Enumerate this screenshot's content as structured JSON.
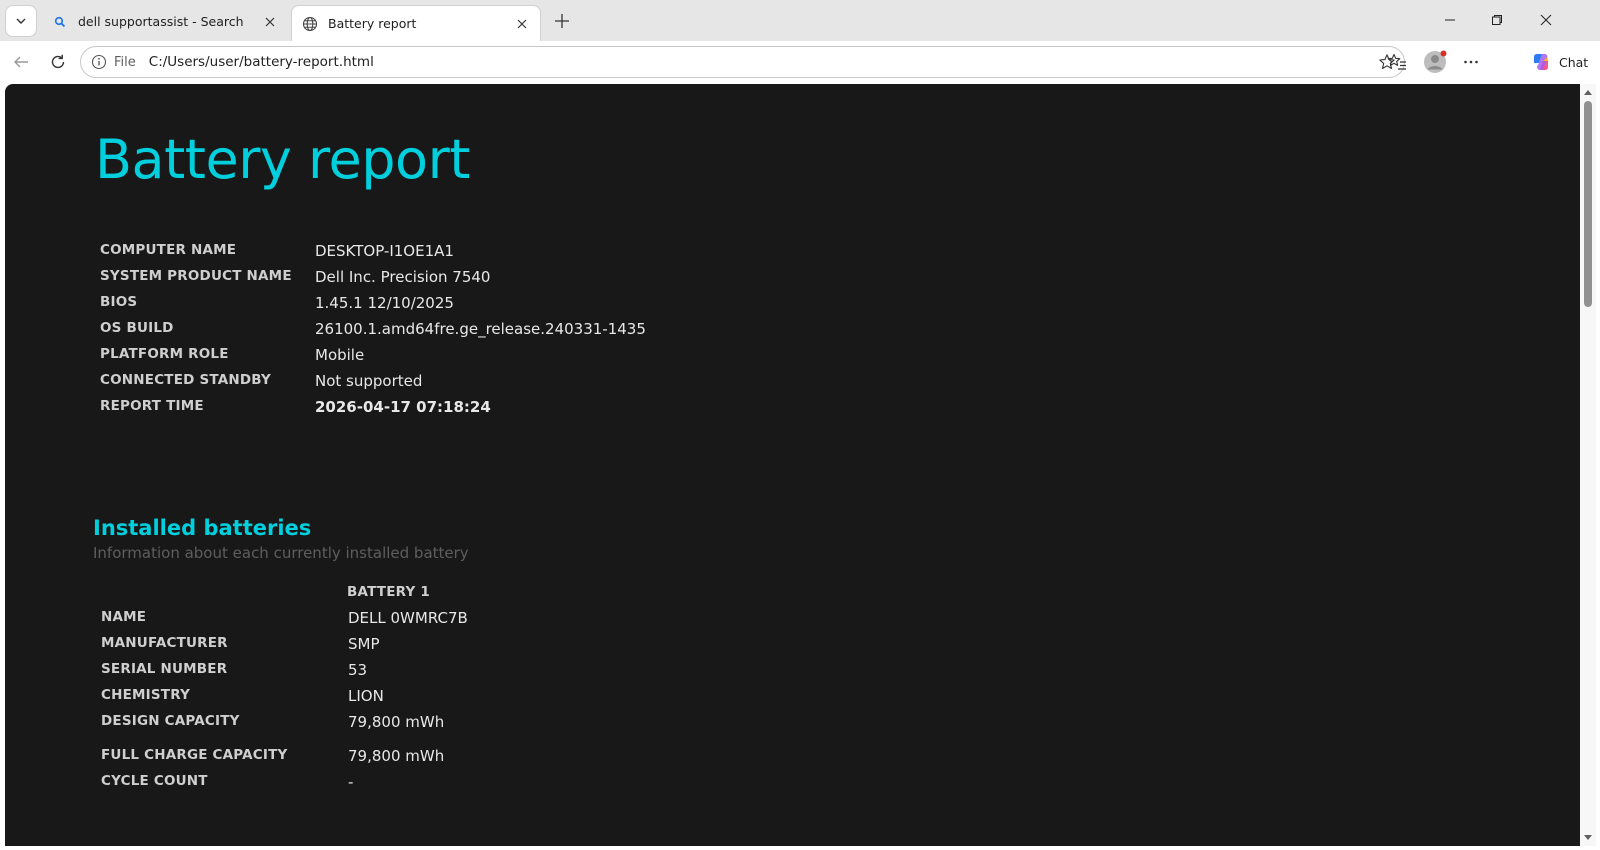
{
  "tabs": [
    {
      "title": "dell supportassist - Search",
      "icon": "search-icon"
    },
    {
      "title": "Battery report",
      "icon": "globe-icon"
    }
  ],
  "address": {
    "scheme_label": "File",
    "url": "C:/Users/user/battery-report.html"
  },
  "toolbar": {
    "chat_label": "Chat"
  },
  "report": {
    "title": "Battery report",
    "system": [
      {
        "label": "COMPUTER NAME",
        "value": "DESKTOP-I1OE1A1"
      },
      {
        "label": "SYSTEM PRODUCT NAME",
        "value": "Dell Inc. Precision 7540"
      },
      {
        "label": "BIOS",
        "value": "1.45.1 12/10/2025"
      },
      {
        "label": "OS BUILD",
        "value": "26100.1.amd64fre.ge_release.240331-1435"
      },
      {
        "label": "PLATFORM ROLE",
        "value": "Mobile"
      },
      {
        "label": "CONNECTED STANDBY",
        "value": "Not supported"
      },
      {
        "label": "REPORT TIME",
        "value": "2026-04-17  07:18:24"
      }
    ],
    "installed": {
      "title": "Installed batteries",
      "subtitle": "Information about each currently installed battery",
      "column": "BATTERY 1",
      "rows": [
        {
          "label": "NAME",
          "value": "DELL 0WMRC7B"
        },
        {
          "label": "MANUFACTURER",
          "value": "SMP"
        },
        {
          "label": "SERIAL NUMBER",
          "value": "53"
        },
        {
          "label": "CHEMISTRY",
          "value": "LION"
        },
        {
          "label": "DESIGN CAPACITY",
          "value": "79,800 mWh"
        },
        {
          "label": "FULL CHARGE CAPACITY",
          "value": "79,800 mWh"
        },
        {
          "label": "CYCLE COUNT",
          "value": "-"
        }
      ]
    }
  },
  "colors": {
    "accent": "#00cfdd",
    "page_background": "#181818",
    "chrome_background": "#e6e6e6"
  }
}
